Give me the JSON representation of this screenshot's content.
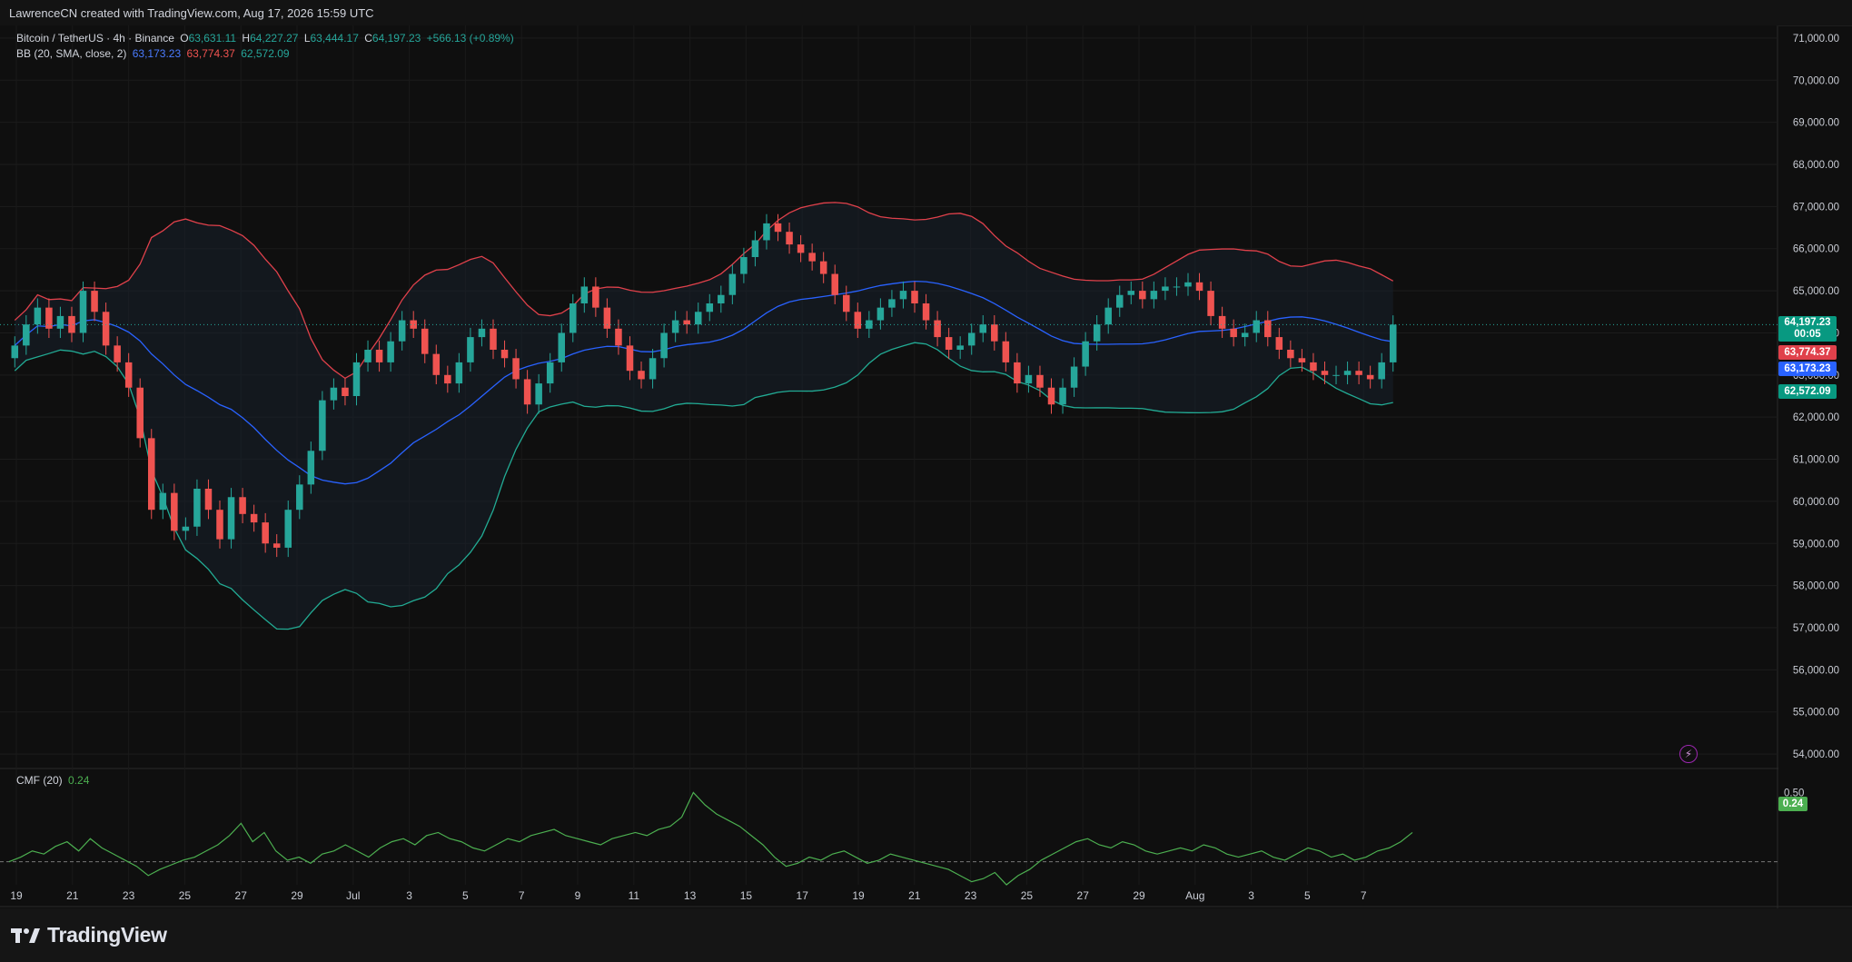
{
  "header": {
    "attribution": "LawrenceCN created with TradingView.com, Aug 17, 2026 15:59 UTC"
  },
  "legend": {
    "symbol": "Bitcoin / TetherUS · 4h · Binance",
    "open_label": "O",
    "open": "63,631.11",
    "high_label": "H",
    "high": "64,227.27",
    "low_label": "L",
    "low": "63,444.17",
    "close_label": "C",
    "close": "64,197.23",
    "change": "+566.13 (+0.89%)",
    "bb_label": "BB (20, SMA, close, 2)",
    "bb_basis": "63,173.23",
    "bb_upper": "63,774.37",
    "bb_lower": "62,572.09",
    "cmf_label": "CMF (20)",
    "cmf_value": "0.24"
  },
  "price_tags": {
    "last_price": "64,197.23",
    "countdown": "00:05",
    "upper": "63,774.37",
    "basis": "63,173.23",
    "lower": "62,572.09",
    "cmf": "0.24"
  },
  "colors": {
    "up": "#26a69a",
    "down": "#ef5350",
    "upper_band": "#e0414b",
    "basis": "#2962ff",
    "lower_band": "#22ab94",
    "cmf": "#4caf50"
  },
  "icons": {
    "alert": "lightning-bolt-icon",
    "logo": "tradingview-logo-icon"
  },
  "branding": {
    "logo_text": "TradingView"
  },
  "chart_data": {
    "type": "candlestick",
    "title": "Bitcoin / TetherUS · 4h · Binance",
    "ylim": [
      53700,
      71300
    ],
    "y_ticks": [
      "71,000.00",
      "70,000.00",
      "69,000.00",
      "68,000.00",
      "67,000.00",
      "66,000.00",
      "65,000.00",
      "64,000.00",
      "63,000.00",
      "62,000.00",
      "61,000.00",
      "60,000.00",
      "59,000.00",
      "58,000.00",
      "57,000.00",
      "56,000.00",
      "55,000.00",
      "54,000.00"
    ],
    "x_ticks": [
      "19",
      "21",
      "23",
      "25",
      "27",
      "29",
      "Jul",
      "3",
      "5",
      "7",
      "9",
      "11",
      "13",
      "15",
      "17",
      "19",
      "21",
      "23",
      "25",
      "27",
      "29",
      "Aug",
      "3",
      "5",
      "7"
    ],
    "closes": [
      63700,
      64200,
      64600,
      64100,
      64400,
      64000,
      65000,
      64500,
      63700,
      63300,
      62700,
      61500,
      59800,
      60200,
      59300,
      59400,
      60300,
      59800,
      59100,
      60100,
      59700,
      59500,
      59000,
      58900,
      59800,
      60400,
      61200,
      62400,
      62700,
      62500,
      63300,
      63600,
      63300,
      63800,
      64300,
      64100,
      63500,
      63000,
      62800,
      63300,
      63900,
      64100,
      63600,
      63400,
      62900,
      62300,
      62800,
      63300,
      64000,
      64700,
      65100,
      64600,
      64100,
      63700,
      63100,
      62900,
      63400,
      64000,
      64300,
      64200,
      64500,
      64700,
      64900,
      65400,
      65800,
      66200,
      66600,
      66400,
      66100,
      65900,
      65700,
      65400,
      64900,
      64500,
      64100,
      64300,
      64600,
      64800,
      65000,
      64700,
      64300,
      63900,
      63600,
      63700,
      64000,
      64200,
      63800,
      63300,
      62800,
      63000,
      62700,
      62300,
      62700,
      63200,
      63800,
      64200,
      64600,
      64900,
      65000,
      64800,
      65000,
      65100,
      65100,
      65200,
      65000,
      64400,
      64100,
      63900,
      64000,
      64300,
      63900,
      63600,
      63400,
      63300,
      63100,
      63000,
      63000,
      63100,
      63000,
      62900,
      63300,
      64197
    ],
    "series": [
      {
        "name": "BB upper",
        "color": "upper_band"
      },
      {
        "name": "BB basis",
        "color": "basis"
      },
      {
        "name": "BB lower",
        "color": "lower_band"
      }
    ],
    "bb": {
      "period": 20,
      "stddev": 2,
      "last_basis": 63173.23,
      "last_upper": 63774.37,
      "last_lower": 62572.09
    },
    "cmf": {
      "name": "CMF (20)",
      "ylim": [
        -0.1,
        0.55
      ],
      "y_ticks": [
        "0.50"
      ],
      "last": 0.24,
      "values": [
        0.05,
        0.08,
        0.12,
        0.1,
        0.15,
        0.18,
        0.12,
        0.2,
        0.14,
        0.1,
        0.06,
        0.02,
        -0.04,
        0.0,
        0.03,
        0.06,
        0.08,
        0.12,
        0.16,
        0.22,
        0.3,
        0.18,
        0.24,
        0.12,
        0.06,
        0.08,
        0.04,
        0.1,
        0.12,
        0.16,
        0.12,
        0.08,
        0.14,
        0.18,
        0.2,
        0.16,
        0.22,
        0.24,
        0.2,
        0.18,
        0.14,
        0.12,
        0.16,
        0.2,
        0.18,
        0.22,
        0.24,
        0.26,
        0.22,
        0.2,
        0.18,
        0.16,
        0.2,
        0.22,
        0.24,
        0.22,
        0.26,
        0.28,
        0.34,
        0.5,
        0.42,
        0.36,
        0.32,
        0.28,
        0.22,
        0.16,
        0.08,
        0.02,
        0.04,
        0.08,
        0.06,
        0.1,
        0.12,
        0.08,
        0.04,
        0.06,
        0.1,
        0.08,
        0.06,
        0.04,
        0.02,
        0.0,
        -0.04,
        -0.08,
        -0.06,
        -0.02,
        -0.1,
        -0.04,
        0.0,
        0.06,
        0.1,
        0.14,
        0.18,
        0.2,
        0.16,
        0.14,
        0.18,
        0.16,
        0.12,
        0.1,
        0.12,
        0.14,
        0.12,
        0.16,
        0.14,
        0.1,
        0.08,
        0.1,
        0.12,
        0.08,
        0.06,
        0.1,
        0.14,
        0.12,
        0.08,
        0.1,
        0.06,
        0.08,
        0.12,
        0.14,
        0.18,
        0.24
      ]
    }
  }
}
